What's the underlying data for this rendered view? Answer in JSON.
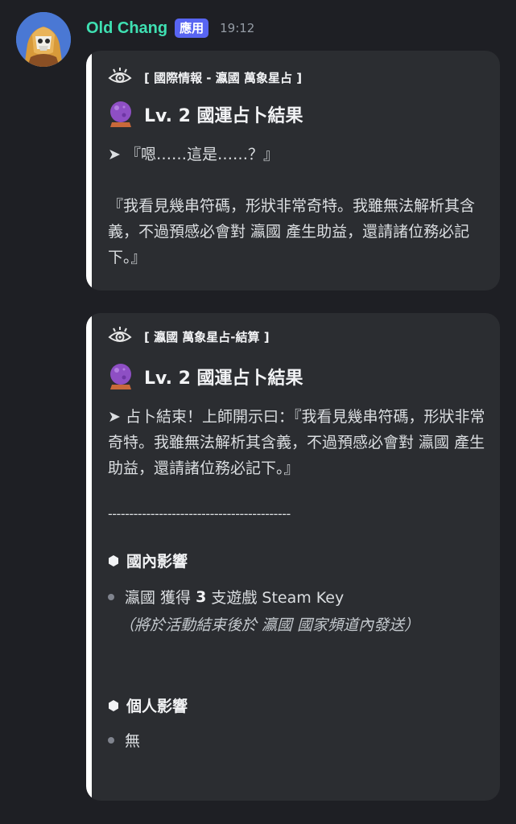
{
  "message": {
    "username": "Old Chang",
    "app_badge": "應用",
    "timestamp": "19:12"
  },
  "embeds": [
    {
      "author": "[ 國際情報 - 瀛國 萬象星占 ]",
      "title": "Lv. 2 國運占卜結果",
      "description_line1": "➤ 『嗯……這是……？』",
      "description_para": "『我看見幾串符碼，形狀非常奇特。我雖無法解析其含義，不過預感必會對 瀛國 產生助益，還請諸位務必記下。』"
    },
    {
      "author": "[ 瀛國 萬象星占-結算 ]",
      "title": "Lv. 2 國運占卜結果",
      "description": "➤ 占卜結束！上師開示曰：『我看見幾串符碼，形狀非常奇特。我雖無法解析其含義，不過預感必會對 瀛國 產生助益，還請諸位務必記下。』",
      "divider": "-------------------------------------------",
      "domestic": {
        "heading": "國內影響",
        "item_prefix": "瀛國 獲得 ",
        "item_number": "3",
        "item_suffix": " 支遊戲 Steam Key",
        "note": "（將於活動結束後於 瀛國 國家頻道內發送）"
      },
      "personal": {
        "heading": "個人影響",
        "item": "無"
      }
    }
  ],
  "icons": {
    "eye": "eye-icon",
    "orb": "crystal-ball-icon",
    "hex": "hexagon-bullet-icon"
  },
  "colors": {
    "background": "#1e1f24",
    "embed_bg": "#2b2d31",
    "embed_accent": "#ffffff",
    "username": "#3fe0b2",
    "badge": "#5865f2"
  }
}
